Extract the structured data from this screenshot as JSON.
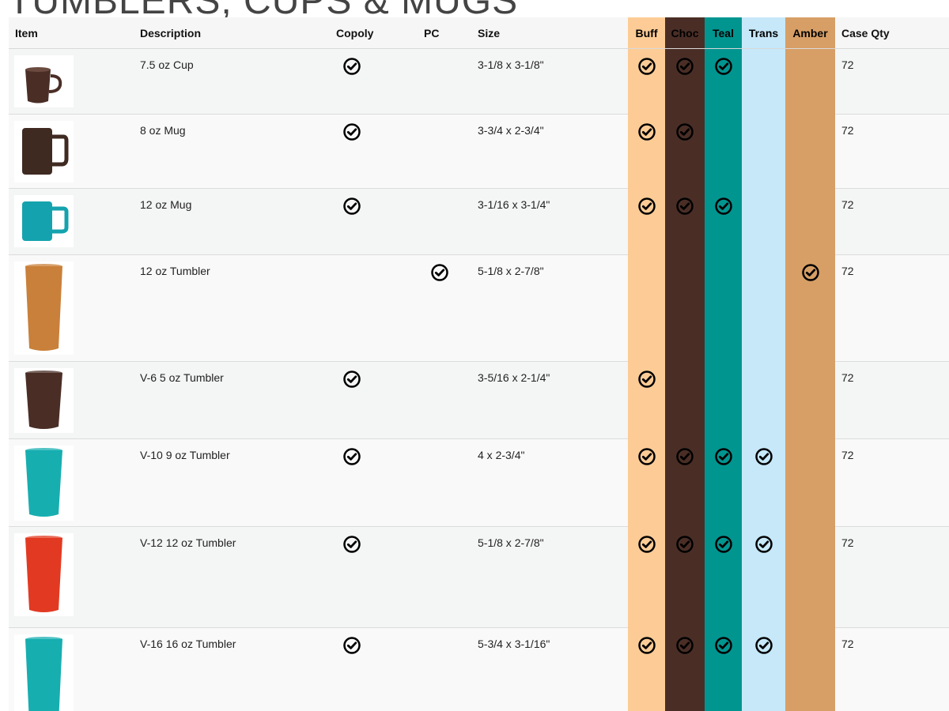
{
  "page": {
    "title": "TUMBLERS, CUPS & MUGS"
  },
  "table": {
    "headers": {
      "item": "Item",
      "description": "Description",
      "copoly": "Copoly",
      "pc": "PC",
      "size": "Size",
      "buff": "Buff",
      "choc": "Choc",
      "teal": "Teal",
      "trans": "Trans",
      "amber": "Amber",
      "case_qty": "Case Qty"
    },
    "column_colors": {
      "buff": "#fdcc96",
      "choc": "#4a2e26",
      "teal": "#019590",
      "trans": "#c6e8f9",
      "amber": "#d79f66"
    },
    "rows": [
      {
        "image": "brown-cup-image",
        "product_color": "#4a2e26",
        "description": "7.5 oz Cup",
        "copoly": true,
        "pc": false,
        "size": "3-1/8 x 3-1/8\"",
        "buff": true,
        "choc": true,
        "teal": true,
        "trans": false,
        "amber": false,
        "case_qty": "72"
      },
      {
        "image": "brown-mug-image",
        "product_color": "#3f2a22",
        "description": "8 oz Mug",
        "copoly": true,
        "pc": false,
        "size": "3-3/4 x 2-3/4\"",
        "buff": true,
        "choc": true,
        "teal": false,
        "trans": false,
        "amber": false,
        "case_qty": "72"
      },
      {
        "image": "teal-mug-image",
        "product_color": "#14a3ae",
        "description": "12 oz Mug",
        "copoly": true,
        "pc": false,
        "size": "3-1/16 x 3-1/4\"",
        "buff": true,
        "choc": true,
        "teal": true,
        "trans": false,
        "amber": false,
        "case_qty": "72"
      },
      {
        "image": "amber-tumbler-image",
        "product_color": "#c9803a",
        "description": "12 oz Tumbler",
        "copoly": false,
        "pc": true,
        "size": "5-1/8 x 2-7/8\"",
        "buff": false,
        "choc": false,
        "teal": false,
        "trans": false,
        "amber": true,
        "case_qty": "72"
      },
      {
        "image": "brown-tumbler-image",
        "product_color": "#4a2e26",
        "description": "V-6 5 oz Tumbler",
        "copoly": true,
        "pc": false,
        "size": "3-5/16 x 2-1/4\"",
        "buff": true,
        "choc": false,
        "teal": false,
        "trans": false,
        "amber": false,
        "case_qty": "72"
      },
      {
        "image": "teal-tumbler-image",
        "product_color": "#17aeb0",
        "description": "V-10 9 oz Tumbler",
        "copoly": true,
        "pc": false,
        "size": "4 x 2-3/4\"",
        "buff": true,
        "choc": true,
        "teal": true,
        "trans": true,
        "amber": false,
        "case_qty": "72"
      },
      {
        "image": "red-tumbler-image",
        "product_color": "#e23a22",
        "description": "V-12 12 oz Tumbler",
        "copoly": true,
        "pc": false,
        "size": "5-1/8 x 2-7/8\"",
        "buff": true,
        "choc": true,
        "teal": true,
        "trans": true,
        "amber": false,
        "case_qty": "72"
      },
      {
        "image": "teal-tall-tumbler-image",
        "product_color": "#17aeb0",
        "description": "V-16 16 oz Tumbler",
        "copoly": true,
        "pc": false,
        "size": "5-3/4 x 3-1/16\"",
        "buff": true,
        "choc": true,
        "teal": true,
        "trans": true,
        "amber": false,
        "case_qty": "72"
      }
    ]
  }
}
